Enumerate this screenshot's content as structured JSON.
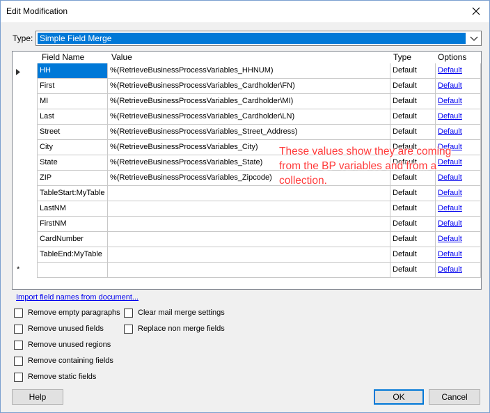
{
  "window": {
    "title": "Edit Modification"
  },
  "type_field": {
    "label": "Type:",
    "value": "Simple Field Merge"
  },
  "grid": {
    "headers": {
      "field_name": "Field Name",
      "value": "Value",
      "type": "Type",
      "options": "Options"
    },
    "ellipsis_label": ">",
    "rows": [
      {
        "field_name": "HH",
        "value": "%(RetrieveBusinessProcessVariables_HHNUM)",
        "type": "Default",
        "options": "Default"
      },
      {
        "field_name": "First",
        "value": "%(RetrieveBusinessProcessVariables_Cardholder\\FN)",
        "type": "Default",
        "options": "Default"
      },
      {
        "field_name": "MI",
        "value": "%(RetrieveBusinessProcessVariables_Cardholder\\MI)",
        "type": "Default",
        "options": "Default"
      },
      {
        "field_name": "Last",
        "value": "%(RetrieveBusinessProcessVariables_Cardholder\\LN)",
        "type": "Default",
        "options": "Default"
      },
      {
        "field_name": "Street",
        "value": "%(RetrieveBusinessProcessVariables_Street_Address)",
        "type": "Default",
        "options": "Default"
      },
      {
        "field_name": "City",
        "value": "%(RetrieveBusinessProcessVariables_City)",
        "type": "Default",
        "options": "Default"
      },
      {
        "field_name": "State",
        "value": "%(RetrieveBusinessProcessVariables_State)",
        "type": "Default",
        "options": "Default"
      },
      {
        "field_name": "ZIP",
        "value": "%(RetrieveBusinessProcessVariables_Zipcode)",
        "type": "Default",
        "options": "Default"
      },
      {
        "field_name": "TableStart:MyTable",
        "value": "",
        "type": "Default",
        "options": "Default"
      },
      {
        "field_name": "LastNM",
        "value": "",
        "type": "Default",
        "options": "Default"
      },
      {
        "field_name": "FirstNM",
        "value": "",
        "type": "Default",
        "options": "Default"
      },
      {
        "field_name": "CardNumber",
        "value": "",
        "type": "Default",
        "options": "Default"
      },
      {
        "field_name": "TableEnd:MyTable",
        "value": "",
        "type": "Default",
        "options": "Default"
      },
      {
        "field_name": "",
        "value": "",
        "type": "Default",
        "options": "Default"
      }
    ],
    "new_row_marker": "*"
  },
  "annotation": {
    "text": "These values show they are coming from the BP variables and from a collection."
  },
  "import_link": "Import field names from document...",
  "checkboxes": {
    "remove_empty_paragraphs": "Remove empty paragraphs",
    "remove_unused_fields": "Remove unused fields",
    "remove_unused_regions": "Remove unused regions",
    "remove_containing_fields": "Remove containing fields",
    "remove_static_fields": "Remove static fields",
    "clear_mail_merge_settings": "Clear mail merge settings",
    "replace_non_merge_fields": "Replace non merge fields"
  },
  "buttons": {
    "help": "Help",
    "ok": "OK",
    "cancel": "Cancel"
  },
  "colors": {
    "selection": "#0078d7",
    "annotation": "#ff3b3b",
    "link": "#0000ee"
  }
}
